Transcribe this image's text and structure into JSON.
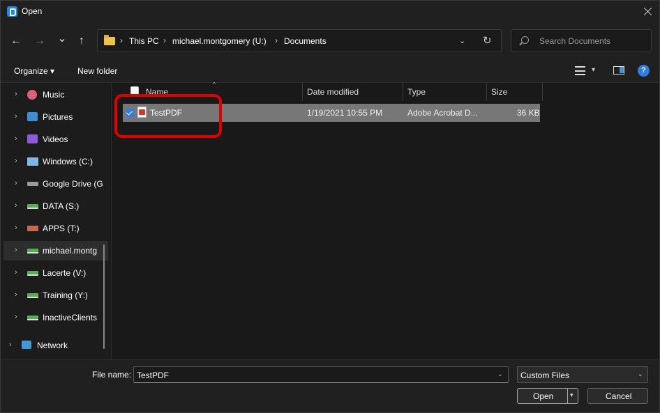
{
  "window": {
    "title": "Open"
  },
  "nav": {
    "back_icon": "←",
    "forward_icon": "→",
    "recent_icon": "⌄",
    "up_icon": "↑",
    "breadcrumbs": [
      "This PC",
      "michael.montgomery (U:)",
      "Documents"
    ],
    "separator": "›",
    "dropdown_icon": "⌄",
    "refresh_icon": "↻"
  },
  "search": {
    "placeholder": "Search Documents"
  },
  "toolbar": {
    "organize_label": "Organize ▾",
    "new_folder_label": "New folder",
    "help_label": "?",
    "view_dd": "▾"
  },
  "sidebar": {
    "chevron": "›",
    "items": [
      {
        "label": "Music",
        "icon": "music-icon"
      },
      {
        "label": "Pictures",
        "icon": "pictures-icon"
      },
      {
        "label": "Videos",
        "icon": "videos-icon"
      },
      {
        "label": "Windows (C:)",
        "icon": "windows-drive-icon"
      },
      {
        "label": "Google Drive (G",
        "icon": "drive-icon"
      },
      {
        "label": "DATA (S:)",
        "icon": "network-drive-icon"
      },
      {
        "label": "APPS (T:)",
        "icon": "network-drive-icon"
      },
      {
        "label": "michael.montg",
        "icon": "network-drive-icon"
      },
      {
        "label": "Lacerte (V:)",
        "icon": "network-drive-icon"
      },
      {
        "label": "Training (Y:)",
        "icon": "network-drive-icon"
      },
      {
        "label": "InactiveClients",
        "icon": "network-drive-icon"
      },
      {
        "label": "Network",
        "icon": "network-icon"
      }
    ]
  },
  "file_list": {
    "columns": [
      "Name",
      "Date modified",
      "Type",
      "Size"
    ],
    "sort_arrow": "^",
    "rows": [
      {
        "name": "TestPDF",
        "date": "1/19/2021 10:55 PM",
        "type": "Adobe Acrobat D...",
        "size": "36 KB",
        "selected": true
      }
    ]
  },
  "footer": {
    "file_name_label": "File name:",
    "file_name_value": "TestPDF",
    "file_type_value": "Custom Files",
    "open_label": "Open",
    "cancel_label": "Cancel",
    "dd": "⌄",
    "split_dd": "▾"
  },
  "colors": {
    "accent": "#2f7de1",
    "highlight": "#e00000",
    "selection": "#777777"
  }
}
